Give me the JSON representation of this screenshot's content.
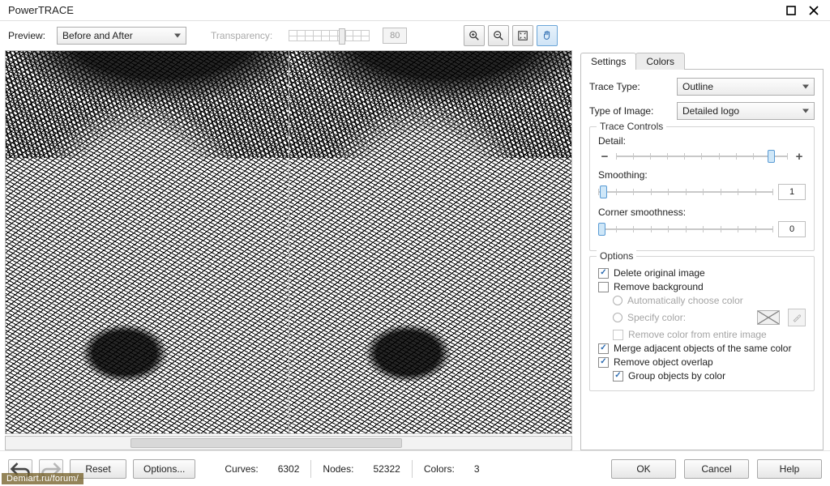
{
  "window": {
    "title": "PowerTRACE"
  },
  "toolbar": {
    "preview_label": "Preview:",
    "preview_value": "Before and After",
    "transparency_label": "Transparency:",
    "transparency_value": "80"
  },
  "tabs": {
    "settings": "Settings",
    "colors": "Colors"
  },
  "settings": {
    "trace_type_label": "Trace Type:",
    "trace_type_value": "Outline",
    "type_of_image_label": "Type of Image:",
    "type_of_image_value": "Detailed logo",
    "trace_controls_label": "Trace Controls",
    "detail_label": "Detail:",
    "smoothing_label": "Smoothing:",
    "smoothing_value": "1",
    "corner_label": "Corner smoothness:",
    "corner_value": "0",
    "options_label": "Options",
    "delete_original": "Delete original image",
    "remove_background": "Remove background",
    "auto_color": "Automatically choose color",
    "specify_color": "Specify color:",
    "remove_entire": "Remove color from entire image",
    "merge_adjacent": "Merge adjacent objects of the same color",
    "remove_overlap": "Remove object overlap",
    "group_by_color": "Group objects by color"
  },
  "footer": {
    "reset": "Reset",
    "options": "Options...",
    "curves_label": "Curves:",
    "curves_value": "6302",
    "nodes_label": "Nodes:",
    "nodes_value": "52322",
    "colors_label": "Colors:",
    "colors_value": "3",
    "ok": "OK",
    "cancel": "Cancel",
    "help": "Help"
  },
  "watermark": "Demiart.ru/forum/"
}
